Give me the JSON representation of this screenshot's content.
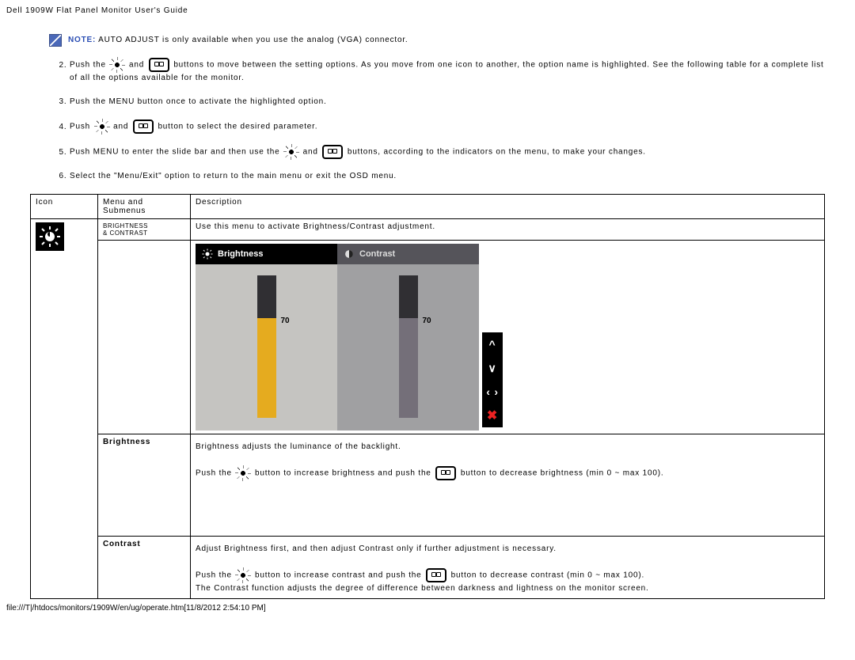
{
  "page_title": "Dell 1909W Flat Panel Monitor User's Guide",
  "note": {
    "label": "NOTE:",
    "text": "AUTO ADJUST is only available when you use the analog (VGA) connector."
  },
  "steps": {
    "s2a": "Push the ",
    "s2b": " and ",
    "s2c": " buttons to move between the setting options. As you move from one icon to another, the option name is highlighted. See the following table for a complete list of all the options available for the monitor.",
    "s3": "Push the MENU button once to activate the highlighted option.",
    "s4a": "Push ",
    "s4b": " and ",
    "s4c": " button to select the desired parameter.",
    "s5a": "Push MENU to enter the slide bar and then use the ",
    "s5b": " and ",
    "s5c": " buttons, according to the indicators on the menu, to make your changes.",
    "s6": "Select the \"Menu/Exit\" option to return to the main menu or exit the OSD menu."
  },
  "table": {
    "headers": {
      "icon": "Icon",
      "menu": "Menu and Submenus",
      "desc": "Description"
    },
    "row1": {
      "menu_line1": "BRIGHTNESS",
      "menu_line2": "& CONTRAST",
      "desc": "Use this menu to activate Brightness/Contrast adjustment."
    },
    "osd": {
      "tab_brightness": "Brightness",
      "tab_contrast": "Contrast",
      "brightness_value": "70",
      "contrast_value": "70"
    },
    "row_brightness": {
      "label": "Brightness",
      "d1": "Brightness adjusts the luminance of the backlight.",
      "d2a": "Push the ",
      "d2b": " button to increase brightness and push the ",
      "d2c": " button to decrease brightness (min 0 ~ max 100)."
    },
    "row_contrast": {
      "label": "Contrast",
      "d1": "Adjust Brightness first, and then adjust Contrast only if further adjustment is necessary.",
      "d2a": "Push the ",
      "d2b": " button to increase contrast and push the ",
      "d2c": " button to decrease contrast (min 0 ~ max 100).",
      "d3": "The Contrast function adjusts the degree of difference between darkness and lightness on the monitor screen."
    }
  },
  "footer": "file:///T|/htdocs/monitors/1909W/en/ug/operate.htm[11/8/2012 2:54:10 PM]",
  "chart_data": {
    "type": "bar",
    "categories": [
      "Brightness",
      "Contrast"
    ],
    "values": [
      70,
      70
    ],
    "ylim": [
      0,
      100
    ],
    "title": "Brightness / Contrast OSD sliders"
  }
}
